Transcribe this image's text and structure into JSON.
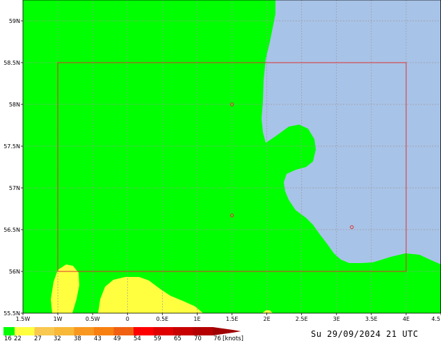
{
  "map": {
    "lat_range": [
      55.5,
      59.25
    ],
    "lon_range": [
      -1.5,
      4.5
    ],
    "lat_ticks": [
      {
        "value": 59,
        "label": "59N"
      },
      {
        "value": 58.5,
        "label": "58.5N"
      },
      {
        "value": 58,
        "label": "58N"
      },
      {
        "value": 57.5,
        "label": "57.5N"
      },
      {
        "value": 57,
        "label": "57N"
      },
      {
        "value": 56.5,
        "label": "56.5N"
      },
      {
        "value": 56,
        "label": "56N"
      },
      {
        "value": 55.5,
        "label": "55.5N"
      }
    ],
    "lon_ticks": [
      {
        "value": -1.5,
        "label": "1.5W"
      },
      {
        "value": -1,
        "label": "1W"
      },
      {
        "value": -0.5,
        "label": "0.5W"
      },
      {
        "value": 0,
        "label": "0"
      },
      {
        "value": 0.5,
        "label": "0.5E"
      },
      {
        "value": 1,
        "label": "1E"
      },
      {
        "value": 1.5,
        "label": "1.5E"
      },
      {
        "value": 2,
        "label": "2E"
      },
      {
        "value": 2.5,
        "label": "2.5E"
      },
      {
        "value": 3,
        "label": "3E"
      },
      {
        "value": 3.5,
        "label": "3.5E"
      },
      {
        "value": 4,
        "label": "4E"
      },
      {
        "value": 4.5,
        "label": "4.5"
      }
    ],
    "region_box": {
      "lon_min": -1,
      "lon_max": 4,
      "lat_min": 56,
      "lat_max": 58.5
    },
    "markers": [
      {
        "lon": 1.5,
        "lat": 58.0
      },
      {
        "lon": 1.5,
        "lat": 56.67
      },
      {
        "lon": 3.22,
        "lat": 56.53
      }
    ],
    "colors": {
      "land_sea_below_16": "#a8c3e8",
      "band_16_22": "#00ff00",
      "band_22_27": "#ffff40",
      "box": "#e03030",
      "marker": "#e03030",
      "grid": "#9a9a9a"
    }
  },
  "legend": {
    "unit_label": "[knots]",
    "labels": [
      "16",
      "22",
      "27",
      "32",
      "38",
      "43",
      "49",
      "54",
      "59",
      "65",
      "70",
      "76"
    ],
    "colors": [
      "#00ff00",
      "#ffff40",
      "#f8c850",
      "#f8b838",
      "#f89820",
      "#f88010",
      "#f06010",
      "#ff0000",
      "#e00000",
      "#c80000",
      "#b40000",
      "#a00000"
    ]
  },
  "timestamp": "Su 29/09/2024 21 UTC"
}
